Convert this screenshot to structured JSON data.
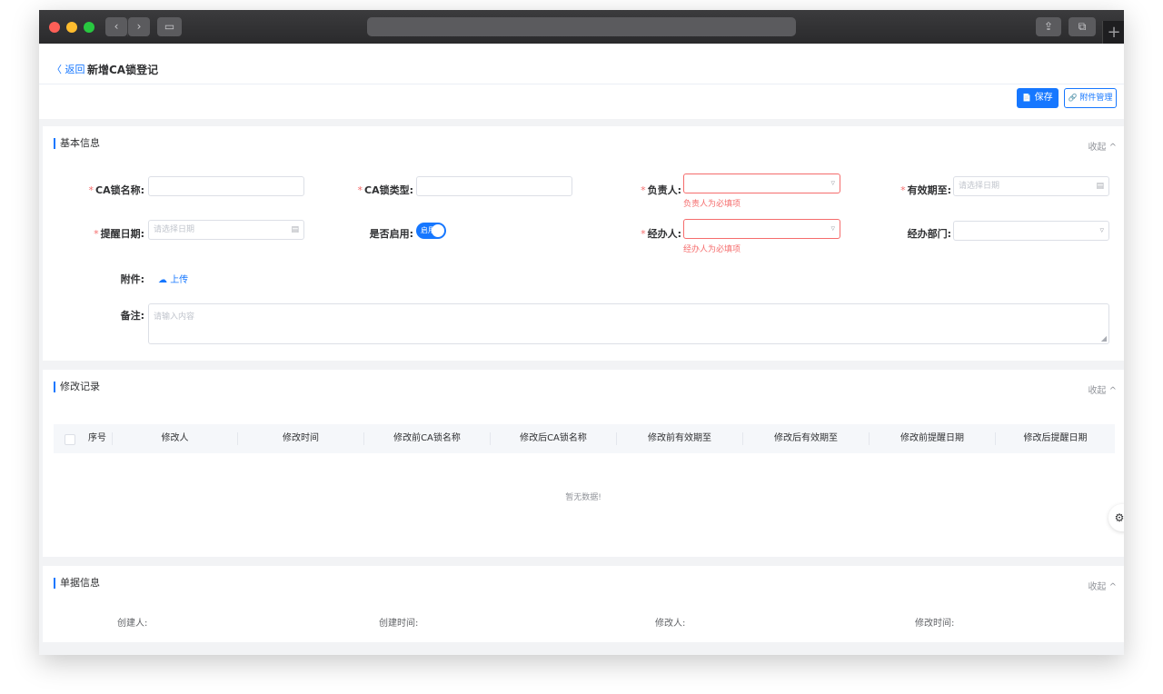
{
  "window": {
    "controls": {
      "back": "‹",
      "forward": "›",
      "sidebar": "▭",
      "share": "⇪",
      "tabs": "⧉",
      "new_tab": "+"
    }
  },
  "header": {
    "back_label": "〈 返回",
    "title": "新增CA锁登记"
  },
  "toolbar": {
    "save_label": "保存",
    "save_icon": "📄",
    "attach_label": "附件管理",
    "attach_icon": "🔗"
  },
  "basic": {
    "title": "基本信息",
    "collapse_label": "收起 ^",
    "fields": {
      "ca_name": {
        "label": "CA锁名称:",
        "value": ""
      },
      "ca_type": {
        "label": "CA锁类型:",
        "value": ""
      },
      "owner": {
        "label": "负责人:",
        "value": "",
        "error": "负责人为必填项"
      },
      "valid_until": {
        "label": "有效期至:",
        "placeholder": "请选择日期"
      },
      "remind_date": {
        "label": "提醒日期:",
        "placeholder": "请选择日期"
      },
      "enabled": {
        "label": "是否启用:",
        "switch_text": "启用",
        "on": true
      },
      "handler": {
        "label": "经办人:",
        "value": "",
        "error": "经办人为必填项"
      },
      "handler_dept": {
        "label": "经办部门:",
        "value": ""
      },
      "attachment": {
        "label": "附件:",
        "upload_label": "上传"
      },
      "remark": {
        "label": "备注:",
        "placeholder": "请输入内容"
      }
    },
    "icons": {
      "select": "▿",
      "calendar": "▤",
      "upload": "☁",
      "resize": "◢"
    }
  },
  "record": {
    "title": "修改记录",
    "collapse_label": "收起 ^",
    "columns": [
      "序号",
      "修改人",
      "修改时间",
      "修改前CA锁名称",
      "修改后CA锁名称",
      "修改前有效期至",
      "修改后有效期至",
      "修改前提醒日期",
      "修改后提醒日期"
    ],
    "empty_text": "暂无数据!",
    "tune_icon": "⚙"
  },
  "doc": {
    "title": "单据信息",
    "collapse_label": "收起 ^",
    "labels": [
      "创建人:",
      "创建时间:",
      "修改人:",
      "修改时间:"
    ]
  },
  "colors": {
    "primary": "#1677ff",
    "danger": "#f56c6c",
    "bg": "#f2f3f5"
  }
}
